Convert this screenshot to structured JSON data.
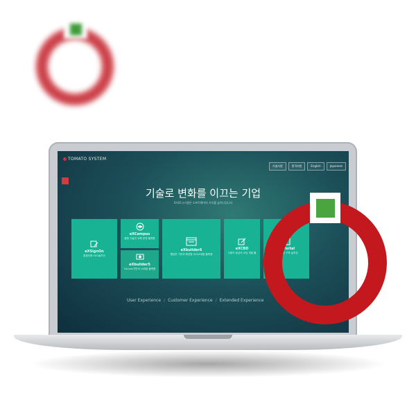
{
  "brand": {
    "name": "TOMATO SYSTEM"
  },
  "nav": {
    "items": [
      "기술지원",
      "원격지원",
      "English",
      "Japanese"
    ]
  },
  "hero": {
    "headline": "기술로 변화를 이끄는 기업",
    "subline": "토마토시스템은 소프트웨어의 가치를 높여나갑니다"
  },
  "tiles": [
    {
      "name": "eXSignOn",
      "desc": "통합인증 SSO솔루션"
    },
    {
      "name": "eXCampus",
      "desc": "통합 기술인 교육 운영 플랫폼"
    },
    {
      "name": "eXbuilder5",
      "desc": "Canvas기반의 UI개발 플랫폼"
    },
    {
      "name": "eXbuilder6",
      "desc": "웹표준 기반의 확장형 UI/UX개발 플랫폼"
    },
    {
      "name": "eXCBD",
      "desc": "사용자 중심의 코딩 개발 툴"
    },
    {
      "name": "eXPortal",
      "desc": "포털 통합 구축 솔루션"
    }
  ],
  "taglines": {
    "user": "User Experience",
    "customer": "Customer Experience",
    "extended": "Extended Experience",
    "separator": "/"
  },
  "colors": {
    "accent_red": "#c4181f",
    "accent_green": "#4aa43f",
    "tile": "#17b394"
  }
}
